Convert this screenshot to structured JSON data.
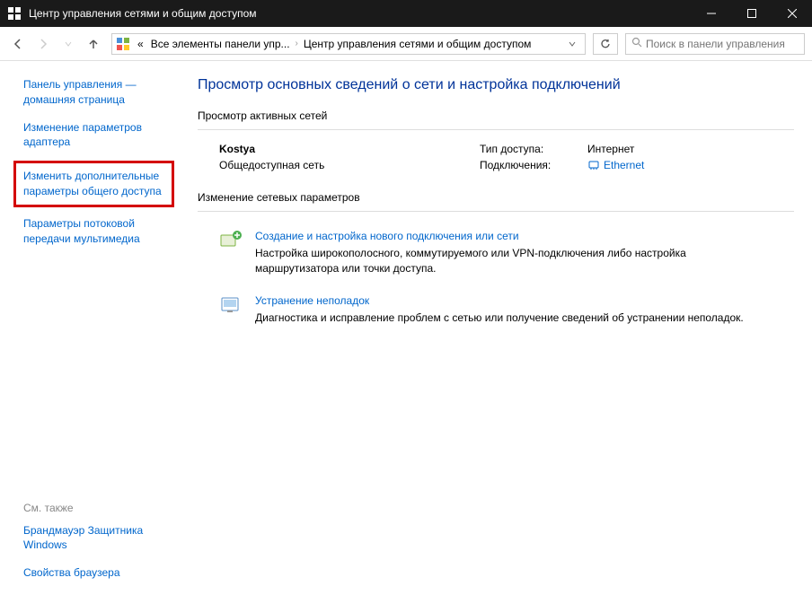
{
  "titlebar": {
    "title": "Центр управления сетями и общим доступом"
  },
  "breadcrumb": {
    "prefix": "«",
    "items": [
      "Все элементы панели упр...",
      "Центр управления сетями и общим доступом"
    ]
  },
  "search": {
    "placeholder": "Поиск в панели управления"
  },
  "sidebar": {
    "links": [
      "Панель управления — домашняя страница",
      "Изменение параметров адаптера",
      "Изменить дополнительные параметры общего доступа",
      "Параметры потоковой передачи мультимедиа"
    ],
    "see_also_label": "См. также",
    "footer_links": [
      "Брандмауэр Защитника Windows",
      "Свойства браузера"
    ]
  },
  "main": {
    "heading": "Просмотр основных сведений о сети и настройка подключений",
    "active_networks_label": "Просмотр активных сетей",
    "network": {
      "name": "Kostya",
      "type": "Общедоступная сеть",
      "access_label": "Тип доступа:",
      "access_value": "Интернет",
      "connections_label": "Подключения:",
      "connection_link": "Ethernet"
    },
    "change_settings_label": "Изменение сетевых параметров",
    "actions": [
      {
        "title": "Создание и настройка нового подключения или сети",
        "desc": "Настройка широкополосного, коммутируемого или VPN-подключения либо настройка маршрутизатора или точки доступа."
      },
      {
        "title": "Устранение неполадок",
        "desc": "Диагностика и исправление проблем с сетью или получение сведений об устранении неполадок."
      }
    ]
  }
}
